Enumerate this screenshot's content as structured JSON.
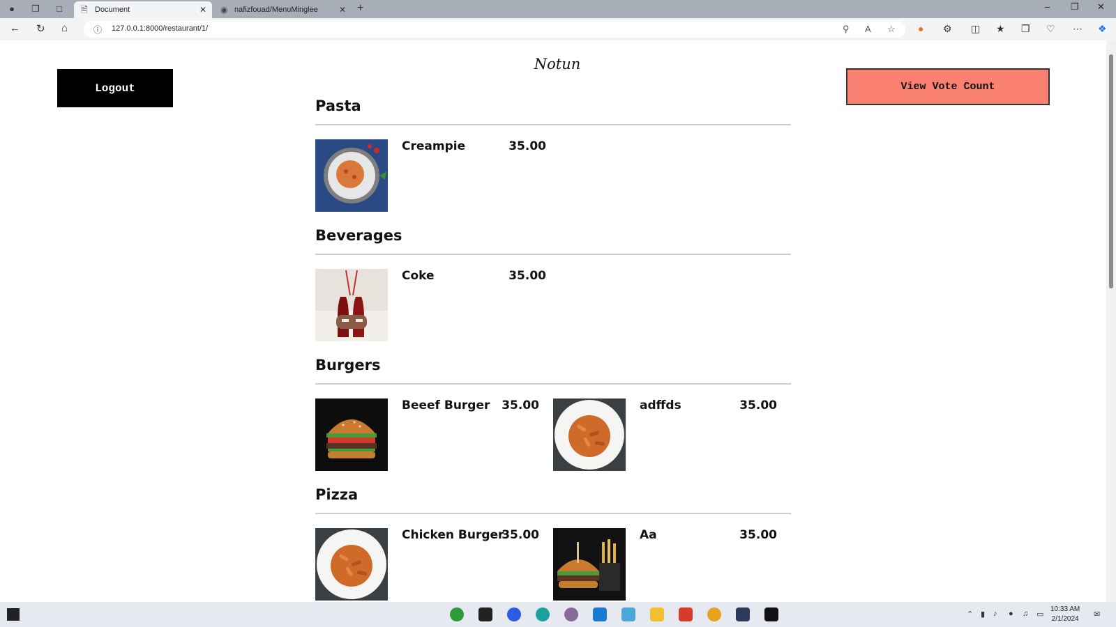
{
  "browser": {
    "tabs": [
      {
        "title": "Document",
        "active": true
      },
      {
        "title": "nafizfouad/MenuMinglee",
        "active": false
      }
    ],
    "url": "127.0.0.1:8000/restaurant/1/"
  },
  "page": {
    "logout_label": "Logout",
    "brand": "Notun",
    "vote_label": "View Vote Count",
    "accent_color": "#fa8072",
    "categories": [
      {
        "title": "Pasta",
        "items": [
          {
            "name": "Creampie",
            "price": "35.00",
            "image": "pasta-bowl-image"
          }
        ]
      },
      {
        "title": "Beverages",
        "items": [
          {
            "name": "Coke",
            "price": "35.00",
            "image": "coke-bottles-image"
          }
        ]
      },
      {
        "title": "Burgers",
        "items": [
          {
            "name": "Beeef Burger",
            "price": "35.00",
            "image": "burger-image"
          },
          {
            "name": "adffds",
            "price": "35.00",
            "image": "penne-plate-image"
          }
        ]
      },
      {
        "title": "Pizza",
        "items": [
          {
            "name": "Chicken Burger",
            "price": "35.00",
            "image": "penne-plate-image"
          },
          {
            "name": "Aa",
            "price": "35.00",
            "image": "burger-fries-image"
          }
        ]
      }
    ]
  },
  "taskbar": {
    "time": "10:33 AM",
    "date": "2/1/2024"
  }
}
